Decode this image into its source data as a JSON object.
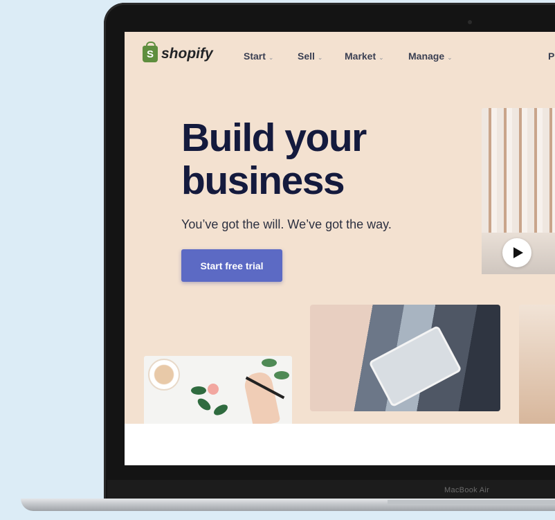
{
  "brand": {
    "name": "shopify",
    "logo_letter": "S",
    "color": "#5e8e3e"
  },
  "nav": {
    "items": [
      {
        "label": "Start"
      },
      {
        "label": "Sell"
      },
      {
        "label": "Market"
      },
      {
        "label": "Manage"
      }
    ],
    "right_partial": "P"
  },
  "hero": {
    "headline_line1": "Build your",
    "headline_line2": "business",
    "subhead": "You’ve got the will. We’ve got the way.",
    "cta_label": "Start free trial"
  },
  "device": {
    "model_label": "MacBook Air"
  },
  "colors": {
    "accent": "#5c6ac4",
    "page_bg": "#f3e1d0",
    "headline": "#141a3d"
  },
  "icons": {
    "play": "play-icon",
    "chevron": "chevron-down-icon",
    "logo": "shopping-bag-icon"
  }
}
